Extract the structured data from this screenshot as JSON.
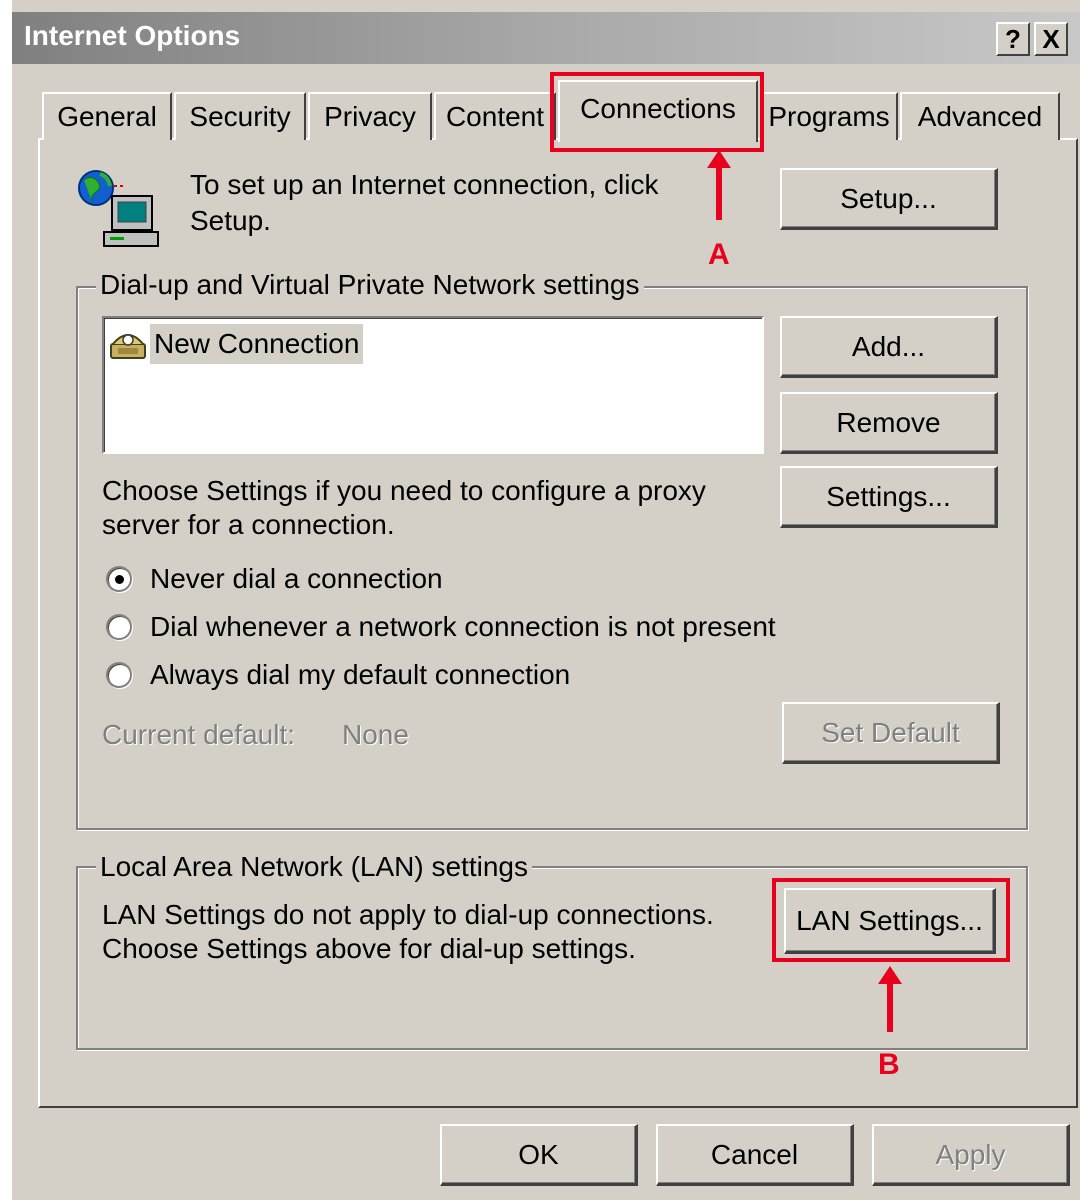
{
  "window": {
    "title": "Internet Options",
    "help_button": "?",
    "close_button": "X"
  },
  "tabs": [
    {
      "label": "General"
    },
    {
      "label": "Security"
    },
    {
      "label": "Privacy"
    },
    {
      "label": "Content"
    },
    {
      "label": "Connections",
      "selected": true
    },
    {
      "label": "Programs"
    },
    {
      "label": "Advanced"
    }
  ],
  "setup": {
    "text_line1": "To set up an Internet connection, click",
    "text_line2": "Setup.",
    "button": "Setup..."
  },
  "dialup": {
    "group_label": "Dial-up and Virtual Private Network settings",
    "connections": [
      {
        "name": "New Connection"
      }
    ],
    "add_button": "Add...",
    "remove_button": "Remove",
    "settings_text_line1": "Choose Settings if you need to configure a proxy",
    "settings_text_line2": "server for a connection.",
    "settings_button": "Settings...",
    "radios": [
      {
        "label": "Never dial a connection",
        "checked": true
      },
      {
        "label": "Dial whenever a network connection is not present",
        "checked": false
      },
      {
        "label": "Always dial my default connection",
        "checked": false
      }
    ],
    "current_default_label": "Current default:",
    "current_default_value": "None",
    "set_default_button": "Set Default"
  },
  "lan": {
    "group_label": "Local Area Network (LAN) settings",
    "text_line1": "LAN Settings do not apply to dial-up connections.",
    "text_line2": "Choose Settings above for dial-up settings.",
    "button": "LAN Settings..."
  },
  "footer": {
    "ok": "OK",
    "cancel": "Cancel",
    "apply": "Apply"
  },
  "annotations": {
    "marker_a": "A",
    "marker_b": "B",
    "color": "#e8001c"
  }
}
